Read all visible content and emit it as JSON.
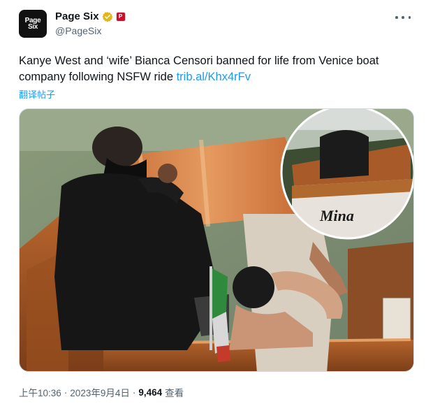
{
  "author": {
    "display_name": "Page Six",
    "handle": "@PageSix",
    "avatar_text_line1": "Page",
    "avatar_text_line2": "Six",
    "affiliate_badge": "P"
  },
  "tweet": {
    "text": "Kanye West and ‘wife’ Bianca Censori banned for life from Venice boat company following NSFW ride ",
    "link_text": "trib.al/Khx4rFv",
    "translate_label": "翻译帖子"
  },
  "media": {
    "boat_name": "Mina"
  },
  "footer": {
    "time": "上午10:36",
    "separator": "·",
    "date": "2023年9月4日",
    "separator2": "·",
    "views_count": "9,464",
    "views_label": "查看"
  },
  "colors": {
    "link": "#1d9bf0",
    "secondary_text": "#536471",
    "primary_text": "#0f1419",
    "verified_gold": "#e2b719"
  },
  "icons": {
    "verified": "verified-gold-badge-icon",
    "more": "more-options-icon"
  }
}
